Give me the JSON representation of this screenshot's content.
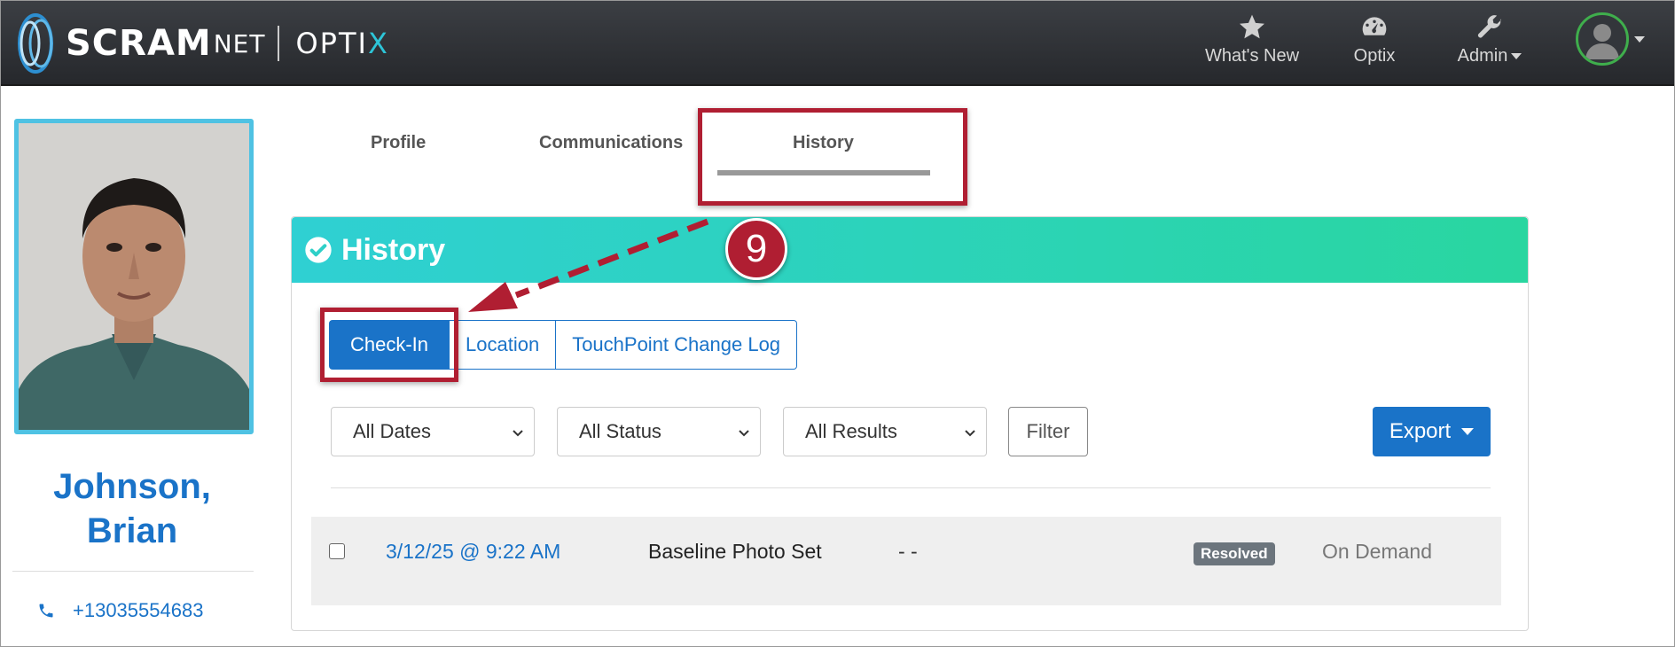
{
  "app": {
    "brand": "SCRAM",
    "brand_suffix": "NET",
    "product_prefix": "OPTI",
    "product_x": "X"
  },
  "nav": {
    "whats_new": "What's New",
    "optix": "Optix",
    "admin": "Admin"
  },
  "profile": {
    "name_line1": "Johnson,",
    "name_line2": "Brian",
    "phone": "+13035554683"
  },
  "tabs": [
    {
      "label": "Profile"
    },
    {
      "label": "Communications"
    },
    {
      "label": "History"
    }
  ],
  "history": {
    "title": "History",
    "subtabs": [
      {
        "label": "Check-In",
        "active": true
      },
      {
        "label": "Location"
      },
      {
        "label": "TouchPoint Change Log"
      }
    ],
    "filters": {
      "dates": "All Dates",
      "status": "All Status",
      "results": "All Results",
      "filter_button": "Filter",
      "export_button": "Export"
    },
    "rows": [
      {
        "date": "3/12/25 @ 9:22 AM",
        "type": "Baseline Photo Set",
        "result": "- -",
        "status": "Resolved",
        "trigger": "On Demand"
      }
    ]
  },
  "annotation": {
    "step": "9",
    "color": "#b01e32"
  },
  "colors": {
    "primary": "#1a73c8",
    "header_gradient_start": "#2fd0d3",
    "header_gradient_end": "#29d6a0"
  }
}
